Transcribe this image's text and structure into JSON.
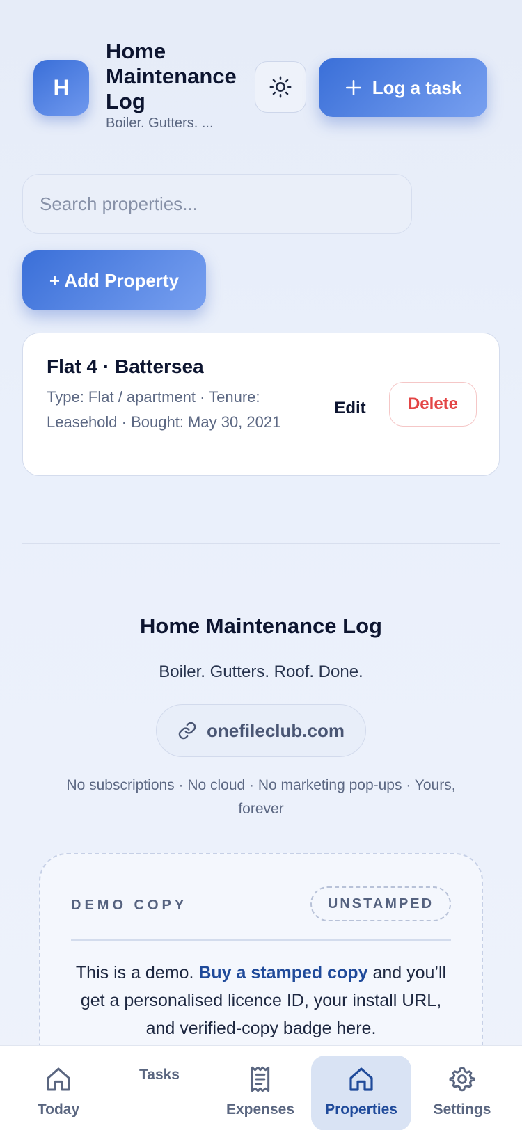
{
  "header": {
    "logo_letter": "H",
    "title": "Home Maintenance Log",
    "subtitle": "Boiler. Gutters. ...",
    "theme_icon": "sun-icon",
    "log_button_label": "Log a task"
  },
  "search": {
    "placeholder": "Search properties..."
  },
  "add_property_label": "+ Add Property",
  "properties": [
    {
      "name": "Flat 4 · Battersea",
      "meta": "Type: Flat / apartment · Tenure: Leasehold · Bought: May 30, 2021",
      "edit_label": "Edit",
      "delete_label": "Delete"
    }
  ],
  "footer": {
    "title": "Home Maintenance Log",
    "tagline": "Boiler. Gutters. Roof. Done.",
    "link_label": "onefileclub.com",
    "note": "No subscriptions · No cloud · No marketing pop-ups · Yours, forever"
  },
  "demo": {
    "label": "DEMO COPY",
    "badge": "UNSTAMPED",
    "text_prefix": "This is a demo.",
    "text_link": "Buy a stamped copy",
    "text_suffix": "and you’ll get a personalised licence ID, your install URL, and verified-copy badge here."
  },
  "nav": {
    "items": [
      {
        "label": "Today",
        "icon": "home-icon",
        "active": false
      },
      {
        "label": "Tasks",
        "icon": "",
        "active": false
      },
      {
        "label": "Expenses",
        "icon": "receipt-icon",
        "active": false
      },
      {
        "label": "Properties",
        "icon": "home-icon",
        "active": true
      },
      {
        "label": "Settings",
        "icon": "gear-icon",
        "active": false
      }
    ]
  },
  "colors": {
    "accent": "#3a6fd8",
    "danger": "#e34545",
    "text": "#0d1530",
    "muted": "#5c6883"
  }
}
